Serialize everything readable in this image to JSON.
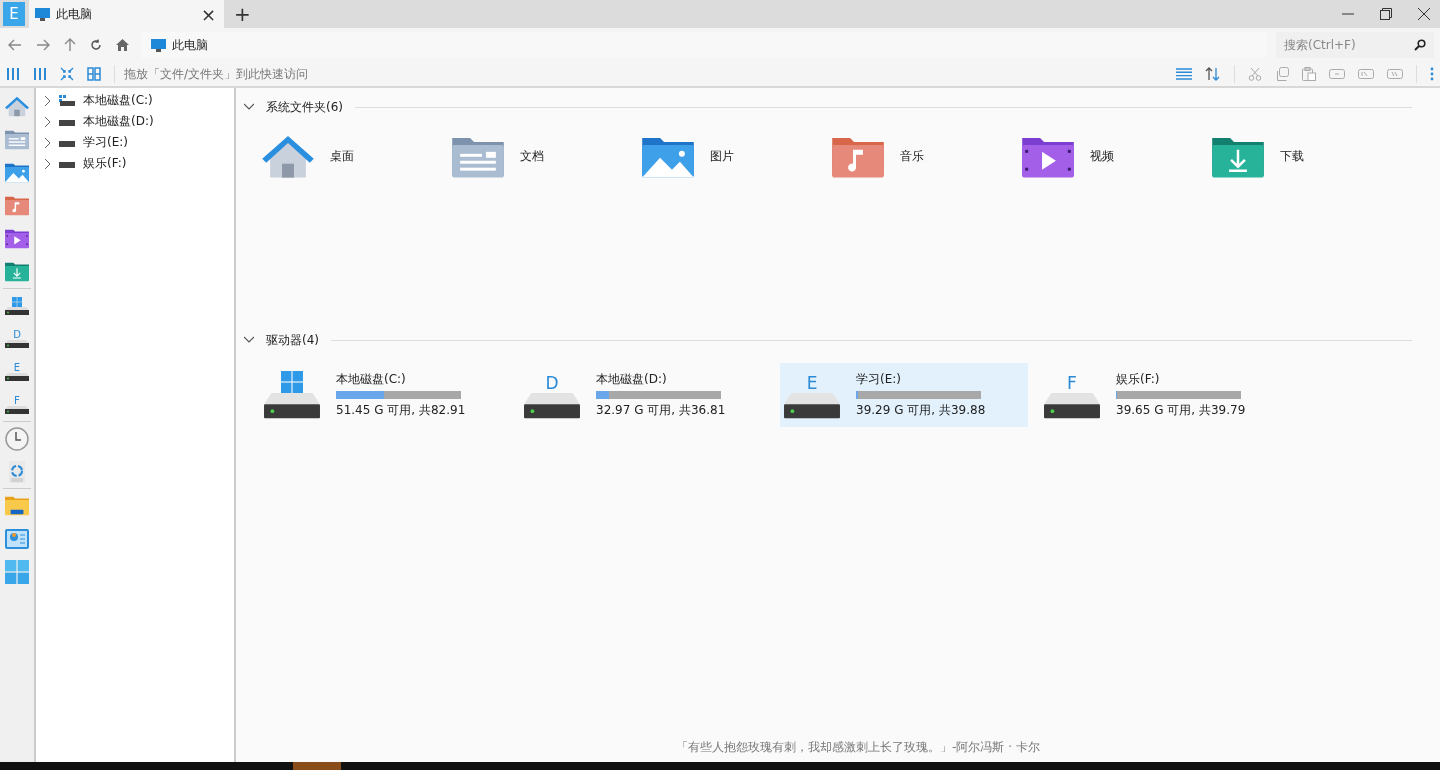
{
  "app": {
    "badge": "E"
  },
  "tab": {
    "title": "此电脑",
    "selected": true,
    "close": "×"
  },
  "new_tab": "+",
  "address": {
    "path": "此电脑"
  },
  "search": {
    "placeholder": "搜索(Ctrl+F)"
  },
  "toolbar": {
    "hint": "拖放「文件/文件夹」到此快速访问"
  },
  "rail": [
    {
      "kind": "home"
    },
    {
      "kind": "documents"
    },
    {
      "kind": "pictures"
    },
    {
      "kind": "music"
    },
    {
      "kind": "videos"
    },
    {
      "kind": "downloads"
    },
    {
      "kind": "separator"
    },
    {
      "kind": "windows-drive"
    },
    {
      "kind": "drive",
      "letter": "D"
    },
    {
      "kind": "drive",
      "letter": "E"
    },
    {
      "kind": "drive",
      "letter": "F"
    },
    {
      "kind": "separator"
    },
    {
      "kind": "clock"
    },
    {
      "kind": "recycle"
    },
    {
      "kind": "separator"
    },
    {
      "kind": "folder"
    },
    {
      "kind": "control"
    },
    {
      "kind": "windows"
    }
  ],
  "tree": [
    {
      "label": "本地磁盘(C:)",
      "kind": "system",
      "expanded": false
    },
    {
      "label": "本地磁盘(D:)",
      "kind": "drive",
      "expanded": false
    },
    {
      "label": "学习(E:)",
      "kind": "drive",
      "expanded": false
    },
    {
      "label": "娱乐(F:)",
      "kind": "drive",
      "expanded": false
    }
  ],
  "sections": [
    {
      "title": "系统文件夹(6)",
      "expanded": true,
      "kind": "folders",
      "items": [
        {
          "name": "桌面",
          "kind": "desktop"
        },
        {
          "name": "文档",
          "kind": "documents"
        },
        {
          "name": "图片",
          "kind": "pictures"
        },
        {
          "name": "音乐",
          "kind": "music"
        },
        {
          "name": "视频",
          "kind": "videos"
        },
        {
          "name": "下载",
          "kind": "downloads"
        }
      ]
    },
    {
      "title": "驱动器(4)",
      "expanded": true,
      "kind": "drives",
      "items": [
        {
          "name": "本地磁盘(C:)",
          "kind": "windows",
          "level": 0.38,
          "info": "51.45 G 可用, 共82.91",
          "selected": false
        },
        {
          "name": "本地磁盘(D:)",
          "kind": "letter",
          "letter": "D",
          "level": 0.1,
          "info": "32.97 G 可用, 共36.81",
          "selected": false
        },
        {
          "name": "学习(E:)",
          "kind": "letter",
          "letter": "E",
          "level": 0.015,
          "info": "39.29 G 可用, 共39.88",
          "selected": true
        },
        {
          "name": "娱乐(F:)",
          "kind": "letter",
          "letter": "F",
          "level": 0.004,
          "info": "39.65 G 可用, 共39.79",
          "selected": false
        }
      ]
    }
  ],
  "quote": "「有些人抱怨玫瑰有刺，我却感激刺上长了玫瑰。」-阿尔冯斯 · 卡尔"
}
